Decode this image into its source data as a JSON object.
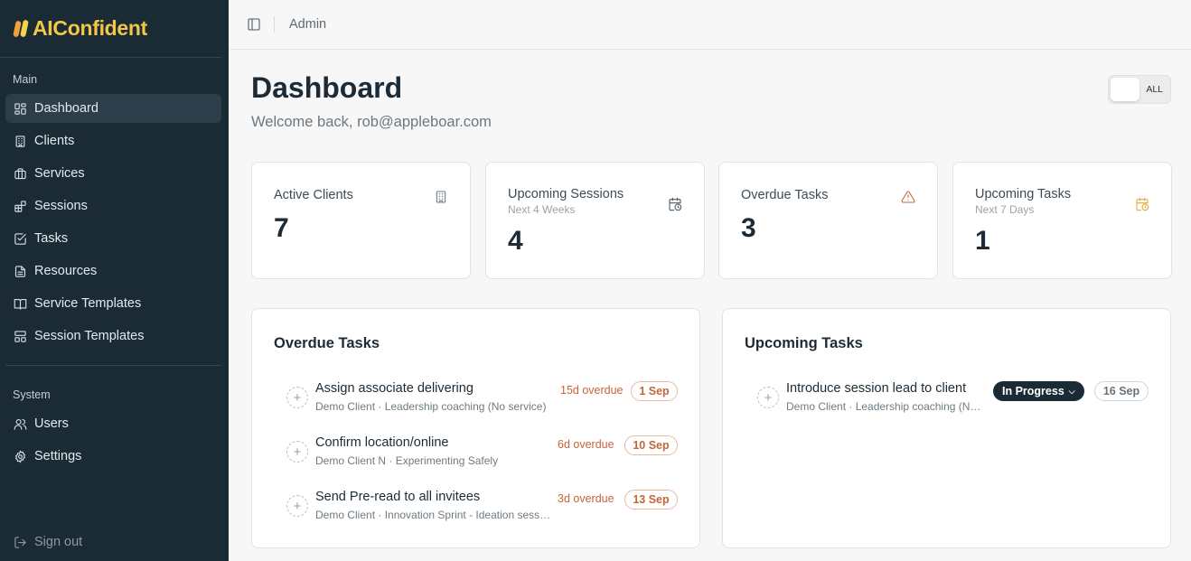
{
  "brand": {
    "name": "AIConfident",
    "accent": "#f2c745",
    "sidebar_bg": "#1b2b36"
  },
  "sidebar": {
    "main_label": "Main",
    "main_items": [
      {
        "label": "Dashboard",
        "icon": "dashboard-icon",
        "active": true
      },
      {
        "label": "Clients",
        "icon": "building-icon"
      },
      {
        "label": "Services",
        "icon": "briefcase-icon"
      },
      {
        "label": "Sessions",
        "icon": "blocks-icon"
      },
      {
        "label": "Tasks",
        "icon": "checkbox-icon"
      },
      {
        "label": "Resources",
        "icon": "document-icon"
      },
      {
        "label": "Service Templates",
        "icon": "book-icon"
      },
      {
        "label": "Session Templates",
        "icon": "layout-icon"
      }
    ],
    "system_label": "System",
    "system_items": [
      {
        "label": "Users",
        "icon": "users-icon"
      },
      {
        "label": "Settings",
        "icon": "gear-icon"
      }
    ],
    "signout_label": "Sign out"
  },
  "topbar": {
    "breadcrumb": "Admin"
  },
  "header": {
    "title": "Dashboard",
    "welcome": "Welcome back, rob@appleboar.com",
    "scope_toggle_label": "ALL"
  },
  "stats": [
    {
      "label": "Active Clients",
      "sub": "",
      "value": "7",
      "icon": "building-icon",
      "icon_color": "#6b7880"
    },
    {
      "label": "Upcoming Sessions",
      "sub": "Next 4 Weeks",
      "value": "4",
      "icon": "calendar-clock-icon",
      "icon_color": "#4a5863"
    },
    {
      "label": "Overdue Tasks",
      "sub": "",
      "value": "3",
      "icon": "warning-icon",
      "icon_color": "#c4653a"
    },
    {
      "label": "Upcoming Tasks",
      "sub": "Next 7 Days",
      "value": "1",
      "icon": "calendar-clock-icon",
      "icon_color": "#e0a93a"
    }
  ],
  "overdue_panel": {
    "title": "Overdue Tasks",
    "tasks": [
      {
        "name": "Assign associate delivering",
        "sub": "Demo Client · Leadership coaching (No service)",
        "overdue": "15d overdue",
        "date": "1 Sep"
      },
      {
        "name": "Confirm location/online",
        "sub": "Demo Client N · Experimenting Safely",
        "overdue": "6d overdue",
        "date": "10 Sep"
      },
      {
        "name": "Send Pre-read to all invitees",
        "sub": "Demo Client · Innovation Sprint - Ideation session",
        "overdue": "3d overdue",
        "date": "13 Sep"
      }
    ]
  },
  "upcoming_panel": {
    "title": "Upcoming Tasks",
    "tasks": [
      {
        "name": "Introduce session lead to client",
        "sub": "Demo Client · Leadership coaching (No service)",
        "status": "In Progress",
        "date": "16 Sep"
      }
    ]
  }
}
